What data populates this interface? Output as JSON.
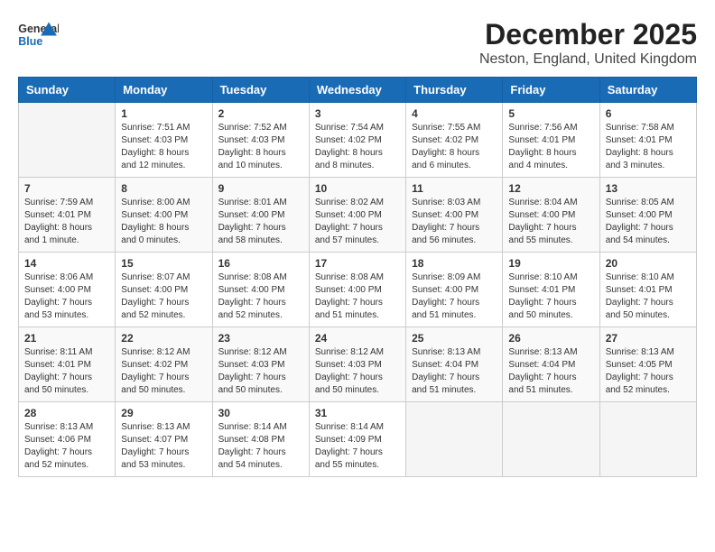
{
  "header": {
    "logo_line1": "General",
    "logo_line2": "Blue",
    "month": "December 2025",
    "location": "Neston, England, United Kingdom"
  },
  "days_of_week": [
    "Sunday",
    "Monday",
    "Tuesday",
    "Wednesday",
    "Thursday",
    "Friday",
    "Saturday"
  ],
  "weeks": [
    [
      {
        "day": "",
        "sunrise": "",
        "sunset": "",
        "daylight": ""
      },
      {
        "day": "1",
        "sunrise": "Sunrise: 7:51 AM",
        "sunset": "Sunset: 4:03 PM",
        "daylight": "Daylight: 8 hours and 12 minutes."
      },
      {
        "day": "2",
        "sunrise": "Sunrise: 7:52 AM",
        "sunset": "Sunset: 4:03 PM",
        "daylight": "Daylight: 8 hours and 10 minutes."
      },
      {
        "day": "3",
        "sunrise": "Sunrise: 7:54 AM",
        "sunset": "Sunset: 4:02 PM",
        "daylight": "Daylight: 8 hours and 8 minutes."
      },
      {
        "day": "4",
        "sunrise": "Sunrise: 7:55 AM",
        "sunset": "Sunset: 4:02 PM",
        "daylight": "Daylight: 8 hours and 6 minutes."
      },
      {
        "day": "5",
        "sunrise": "Sunrise: 7:56 AM",
        "sunset": "Sunset: 4:01 PM",
        "daylight": "Daylight: 8 hours and 4 minutes."
      },
      {
        "day": "6",
        "sunrise": "Sunrise: 7:58 AM",
        "sunset": "Sunset: 4:01 PM",
        "daylight": "Daylight: 8 hours and 3 minutes."
      }
    ],
    [
      {
        "day": "7",
        "sunrise": "Sunrise: 7:59 AM",
        "sunset": "Sunset: 4:01 PM",
        "daylight": "Daylight: 8 hours and 1 minute."
      },
      {
        "day": "8",
        "sunrise": "Sunrise: 8:00 AM",
        "sunset": "Sunset: 4:00 PM",
        "daylight": "Daylight: 8 hours and 0 minutes."
      },
      {
        "day": "9",
        "sunrise": "Sunrise: 8:01 AM",
        "sunset": "Sunset: 4:00 PM",
        "daylight": "Daylight: 7 hours and 58 minutes."
      },
      {
        "day": "10",
        "sunrise": "Sunrise: 8:02 AM",
        "sunset": "Sunset: 4:00 PM",
        "daylight": "Daylight: 7 hours and 57 minutes."
      },
      {
        "day": "11",
        "sunrise": "Sunrise: 8:03 AM",
        "sunset": "Sunset: 4:00 PM",
        "daylight": "Daylight: 7 hours and 56 minutes."
      },
      {
        "day": "12",
        "sunrise": "Sunrise: 8:04 AM",
        "sunset": "Sunset: 4:00 PM",
        "daylight": "Daylight: 7 hours and 55 minutes."
      },
      {
        "day": "13",
        "sunrise": "Sunrise: 8:05 AM",
        "sunset": "Sunset: 4:00 PM",
        "daylight": "Daylight: 7 hours and 54 minutes."
      }
    ],
    [
      {
        "day": "14",
        "sunrise": "Sunrise: 8:06 AM",
        "sunset": "Sunset: 4:00 PM",
        "daylight": "Daylight: 7 hours and 53 minutes."
      },
      {
        "day": "15",
        "sunrise": "Sunrise: 8:07 AM",
        "sunset": "Sunset: 4:00 PM",
        "daylight": "Daylight: 7 hours and 52 minutes."
      },
      {
        "day": "16",
        "sunrise": "Sunrise: 8:08 AM",
        "sunset": "Sunset: 4:00 PM",
        "daylight": "Daylight: 7 hours and 52 minutes."
      },
      {
        "day": "17",
        "sunrise": "Sunrise: 8:08 AM",
        "sunset": "Sunset: 4:00 PM",
        "daylight": "Daylight: 7 hours and 51 minutes."
      },
      {
        "day": "18",
        "sunrise": "Sunrise: 8:09 AM",
        "sunset": "Sunset: 4:00 PM",
        "daylight": "Daylight: 7 hours and 51 minutes."
      },
      {
        "day": "19",
        "sunrise": "Sunrise: 8:10 AM",
        "sunset": "Sunset: 4:01 PM",
        "daylight": "Daylight: 7 hours and 50 minutes."
      },
      {
        "day": "20",
        "sunrise": "Sunrise: 8:10 AM",
        "sunset": "Sunset: 4:01 PM",
        "daylight": "Daylight: 7 hours and 50 minutes."
      }
    ],
    [
      {
        "day": "21",
        "sunrise": "Sunrise: 8:11 AM",
        "sunset": "Sunset: 4:01 PM",
        "daylight": "Daylight: 7 hours and 50 minutes."
      },
      {
        "day": "22",
        "sunrise": "Sunrise: 8:12 AM",
        "sunset": "Sunset: 4:02 PM",
        "daylight": "Daylight: 7 hours and 50 minutes."
      },
      {
        "day": "23",
        "sunrise": "Sunrise: 8:12 AM",
        "sunset": "Sunset: 4:03 PM",
        "daylight": "Daylight: 7 hours and 50 minutes."
      },
      {
        "day": "24",
        "sunrise": "Sunrise: 8:12 AM",
        "sunset": "Sunset: 4:03 PM",
        "daylight": "Daylight: 7 hours and 50 minutes."
      },
      {
        "day": "25",
        "sunrise": "Sunrise: 8:13 AM",
        "sunset": "Sunset: 4:04 PM",
        "daylight": "Daylight: 7 hours and 51 minutes."
      },
      {
        "day": "26",
        "sunrise": "Sunrise: 8:13 AM",
        "sunset": "Sunset: 4:04 PM",
        "daylight": "Daylight: 7 hours and 51 minutes."
      },
      {
        "day": "27",
        "sunrise": "Sunrise: 8:13 AM",
        "sunset": "Sunset: 4:05 PM",
        "daylight": "Daylight: 7 hours and 52 minutes."
      }
    ],
    [
      {
        "day": "28",
        "sunrise": "Sunrise: 8:13 AM",
        "sunset": "Sunset: 4:06 PM",
        "daylight": "Daylight: 7 hours and 52 minutes."
      },
      {
        "day": "29",
        "sunrise": "Sunrise: 8:13 AM",
        "sunset": "Sunset: 4:07 PM",
        "daylight": "Daylight: 7 hours and 53 minutes."
      },
      {
        "day": "30",
        "sunrise": "Sunrise: 8:14 AM",
        "sunset": "Sunset: 4:08 PM",
        "daylight": "Daylight: 7 hours and 54 minutes."
      },
      {
        "day": "31",
        "sunrise": "Sunrise: 8:14 AM",
        "sunset": "Sunset: 4:09 PM",
        "daylight": "Daylight: 7 hours and 55 minutes."
      },
      {
        "day": "",
        "sunrise": "",
        "sunset": "",
        "daylight": ""
      },
      {
        "day": "",
        "sunrise": "",
        "sunset": "",
        "daylight": ""
      },
      {
        "day": "",
        "sunrise": "",
        "sunset": "",
        "daylight": ""
      }
    ]
  ]
}
